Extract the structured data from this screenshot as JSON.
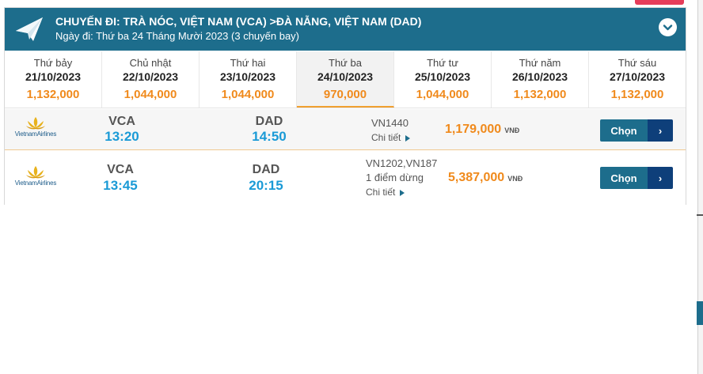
{
  "header": {
    "route": "CHUYẾN ĐI: TRÀ NÓC, VIỆT NAM (VCA) >ĐÀ NẴNG, VIỆT NAM (DAD)",
    "subline": "Ngày đi: Thứ ba 24 Tháng Mười 2023 (3 chuyến bay)",
    "icon": "paper-plane-icon",
    "collapse_icon": "chevron-down-icon",
    "color": "#1d6d8c"
  },
  "dates": [
    {
      "day": "Thứ bảy",
      "date": "21/10/2023",
      "price": "1,132,000",
      "selected": false
    },
    {
      "day": "Chủ nhật",
      "date": "22/10/2023",
      "price": "1,044,000",
      "selected": false
    },
    {
      "day": "Thứ hai",
      "date": "23/10/2023",
      "price": "1,044,000",
      "selected": false
    },
    {
      "day": "Thứ ba",
      "date": "24/10/2023",
      "price": "970,000",
      "selected": true
    },
    {
      "day": "Thứ tư",
      "date": "25/10/2023",
      "price": "1,044,000",
      "selected": false
    },
    {
      "day": "Thứ năm",
      "date": "26/10/2023",
      "price": "1,132,000",
      "selected": false
    },
    {
      "day": "Thứ sáu",
      "date": "27/10/2023",
      "price": "1,132,000",
      "selected": false
    }
  ],
  "flights": [
    {
      "airline": "VietnamAirlines",
      "from_code": "VCA",
      "from_time": "13:20",
      "to_code": "DAD",
      "to_time": "14:50",
      "flight_no": "VN1440",
      "stops": "",
      "detail": "Chi tiết",
      "price": "1,179,000",
      "currency": "VNĐ",
      "button": "Chọn",
      "button_arrow": "›"
    },
    {
      "airline": "VietnamAirlines",
      "from_code": "VCA",
      "from_time": "13:45",
      "to_code": "DAD",
      "to_time": "20:15",
      "flight_no": "VN1202,VN187",
      "stops": "1 điểm dừng",
      "detail": "Chi tiết",
      "price": "5,387,000",
      "currency": "VNĐ",
      "button": "Chọn",
      "button_arrow": "›"
    }
  ],
  "colors": {
    "accent_price": "#f08a1c",
    "time_blue": "#1a9ad6",
    "button_main": "#1d6d8c",
    "button_dark": "#0e3f7a"
  }
}
